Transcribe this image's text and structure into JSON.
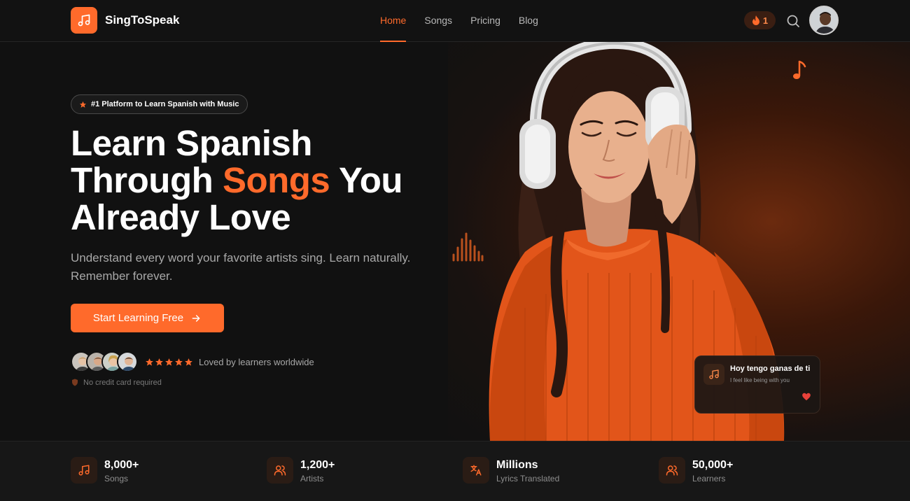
{
  "brand": {
    "name": "SingToSpeak",
    "accent_color": "#ff6a2b",
    "logo_icon": "music-note-icon"
  },
  "nav": {
    "links": [
      {
        "label": "Home",
        "active": true
      },
      {
        "label": "Songs",
        "active": false
      },
      {
        "label": "Pricing",
        "active": false
      },
      {
        "label": "Blog",
        "active": false
      }
    ],
    "streak_count": "1",
    "streak_icon": "flame-icon",
    "search_icon": "search-icon",
    "avatar_icon": "user-avatar"
  },
  "hero": {
    "badge": "#1 Platform to Learn Spanish with Music",
    "headline": {
      "line1": "Learn Spanish",
      "line2_before": "Through ",
      "line2_accent": "Songs",
      "line2_after": " You",
      "line3": "Already Love"
    },
    "subtext_line1": "Understand every word your favorite artists sing. Learn naturally.",
    "subtext_line2": "Remember forever.",
    "cta_label": "Start Learning Free",
    "rating_stars": 5,
    "social_proof": "Loved by learners worldwide",
    "no_card": "No credit card required"
  },
  "lyric_card": {
    "spanish": "Hoy tengo ganas de ti",
    "english": "I feel like being with you",
    "icon": "music-note-icon",
    "heart_icon": "heart-icon"
  },
  "stats": [
    {
      "value": "8,000+",
      "label": "Songs",
      "icon": "music-note-icon"
    },
    {
      "value": "1,200+",
      "label": "Artists",
      "icon": "users-icon"
    },
    {
      "value": "Millions",
      "label": "Lyrics Translated",
      "icon": "translate-icon"
    },
    {
      "value": "50,000+",
      "label": "Learners",
      "icon": "users-icon"
    }
  ]
}
